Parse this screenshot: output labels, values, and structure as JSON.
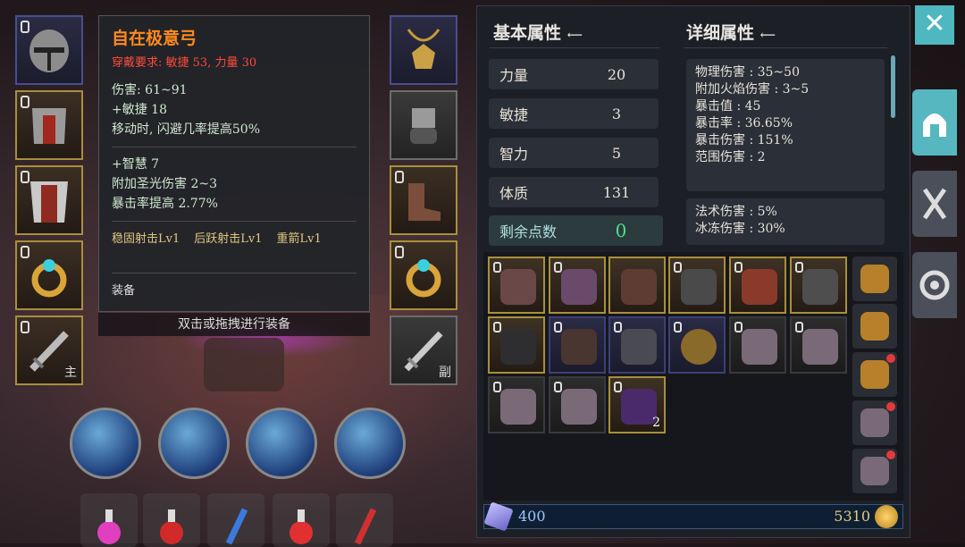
{
  "tooltip": {
    "title": "自在极意弓",
    "requirement": "穿戴要求:  敏捷 53, 力量 30",
    "lines_a": [
      "伤害:  61~91",
      "+敏捷 18",
      "移动时, 闪避几率提高50%"
    ],
    "lines_b": [
      "+智慧  7",
      "附加圣光伤害 2~3",
      "暴击率提高  2.77%"
    ],
    "skills": [
      "稳固射击Lv1",
      "后跃射击Lv1",
      "重箭Lv1"
    ],
    "category": "装备"
  },
  "hint": "双击或拖拽进行装备",
  "left_slots": [
    {
      "name": "helmet-slot",
      "tag": ""
    },
    {
      "name": "chest-armor-slot",
      "tag": ""
    },
    {
      "name": "robe-slot",
      "tag": ""
    },
    {
      "name": "ring-slot-left",
      "tag": ""
    },
    {
      "name": "main-weapon-slot",
      "tag": "主"
    }
  ],
  "right_slots": [
    {
      "name": "amulet-slot",
      "tag": ""
    },
    {
      "name": "gloves-slot",
      "tag": ""
    },
    {
      "name": "boots-slot",
      "tag": ""
    },
    {
      "name": "ring-slot-right",
      "tag": ""
    },
    {
      "name": "off-weapon-slot",
      "tag": "副"
    }
  ],
  "basic": {
    "title": "基本属性",
    "stats": [
      {
        "label": "力量",
        "value": "20"
      },
      {
        "label": "敏捷",
        "value": "3"
      },
      {
        "label": "智力",
        "value": "5"
      },
      {
        "label": "体质",
        "value": "131"
      }
    ],
    "remaining_label": "剩余点数",
    "remaining_value": "0"
  },
  "detail": {
    "title": "详细属性",
    "group1": [
      "物理伤害 : 35~50",
      "附加火焰伤害 : 3~5",
      "暴击值 : 45",
      "暴击率 : 36.65%",
      "暴击伤害 : 151%",
      "范围伤害 : 2"
    ],
    "group2": [
      "法术伤害 : 5%",
      "冰冻伤害 : 30%"
    ]
  },
  "inventory": {
    "cells": [
      {
        "icon": "scythe-icon",
        "count": ""
      },
      {
        "icon": "staff-icon",
        "count": ""
      },
      {
        "icon": "bow-icon",
        "count": ""
      },
      {
        "icon": "sword-icon",
        "count": ""
      },
      {
        "icon": "amulet-icon",
        "count": ""
      },
      {
        "icon": "gloves-icon",
        "count": ""
      },
      {
        "icon": "armor-icon",
        "count": ""
      },
      {
        "icon": "boots-icon",
        "count": ""
      },
      {
        "icon": "greatsword-icon",
        "count": ""
      },
      {
        "icon": "bracelet-icon",
        "count": ""
      },
      {
        "icon": "bag-icon",
        "count": ""
      },
      {
        "icon": "bag-icon",
        "count": ""
      },
      {
        "icon": "bag-icon",
        "count": ""
      },
      {
        "icon": "bag-icon",
        "count": ""
      },
      {
        "icon": "crystal-icon",
        "count": "2"
      }
    ]
  },
  "currency": {
    "gems": "400",
    "gold": "5310"
  },
  "colors": {
    "accent": "#4fb7bf",
    "title_orange": "#ff8a1e",
    "req_red": "#ff4a3a",
    "remaining_green": "#4ce08a"
  }
}
